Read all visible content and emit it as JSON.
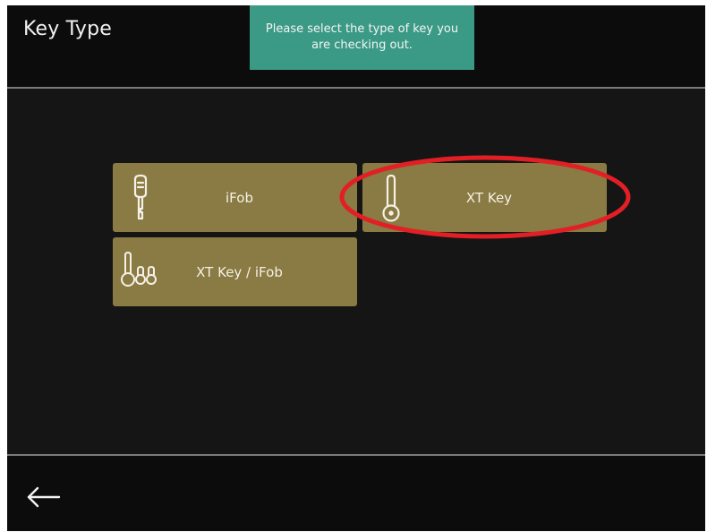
{
  "header": {
    "title": "Key Type",
    "toast_message": "Please select the type of key you are checking out."
  },
  "options": [
    {
      "label": "iFob",
      "icon": "ifob-key-icon"
    },
    {
      "label": "XT Key",
      "icon": "xt-key-icon"
    },
    {
      "label": "XT Key / iFob",
      "icon": "xt-key-ifob-icon"
    }
  ],
  "footer": {
    "back_icon": "arrow-left-icon"
  },
  "colors": {
    "background": "#151515",
    "bar": "#0c0c0c",
    "toast": "#3a9a86",
    "button": "#8a7a43",
    "highlight": "#e21f25"
  }
}
